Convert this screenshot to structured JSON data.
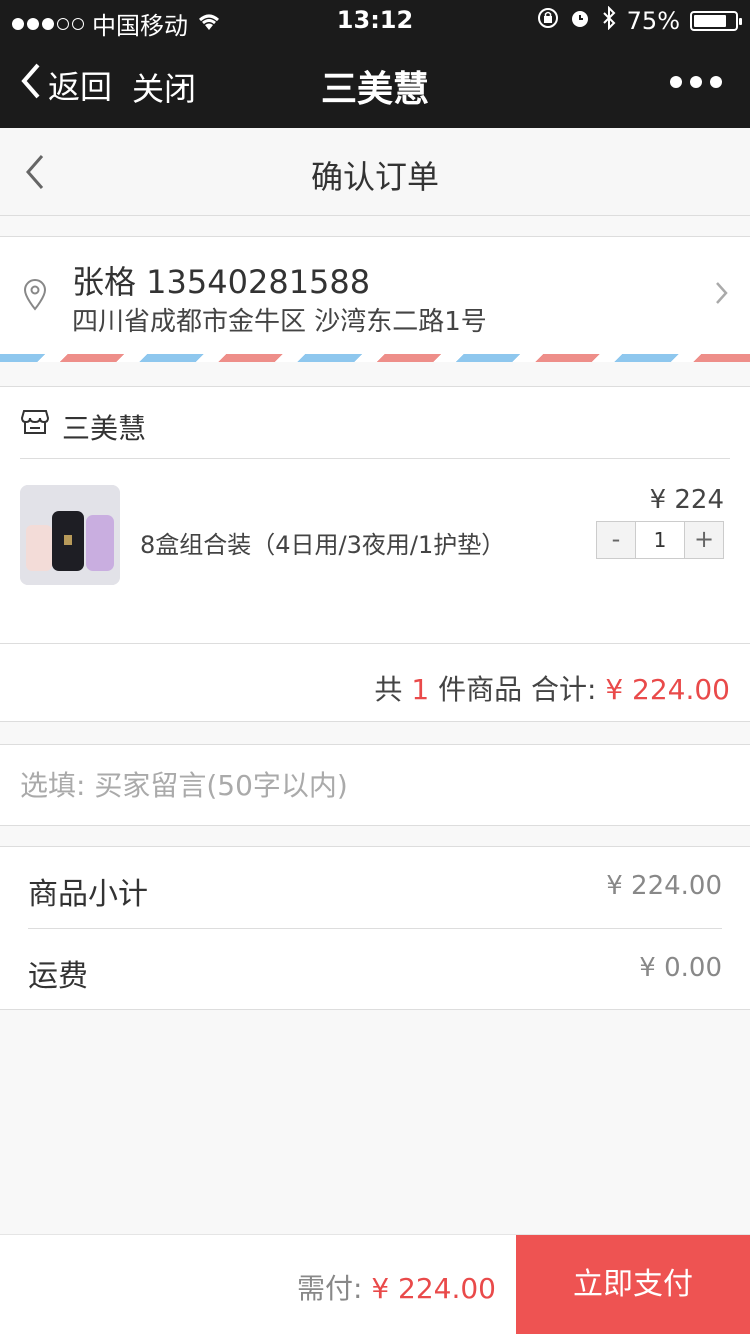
{
  "status_bar": {
    "carrier": "中国移动",
    "time": "13:12",
    "battery": "75%",
    "battery_level": 0.75,
    "icons": [
      "wifi-icon",
      "orientation-lock-icon",
      "alarm-icon",
      "bluetooth-icon",
      "battery-icon"
    ]
  },
  "nav": {
    "back_label": "返回",
    "close_label": "关闭",
    "title": "三美慧",
    "more_icon": "more-dots-icon"
  },
  "header": {
    "title": "确认订单"
  },
  "address": {
    "name_phone": "张格 13540281588",
    "detail": "四川省成都市金牛区 沙湾东二路1号"
  },
  "shop": {
    "name": "三美慧",
    "product": {
      "name": "8盒组合装（4日用/3夜用/1护垫）",
      "price": "¥ 224",
      "quantity": "1",
      "minus": "-",
      "plus": "+"
    },
    "total": {
      "prefix": "共",
      "count": "1",
      "middle": "件商品 合计:",
      "amount": "¥ 224.00"
    }
  },
  "message": {
    "placeholder": "选填: 买家留言(50字以内)"
  },
  "summary": {
    "subtotal_label": "商品小计",
    "subtotal_value": "¥ 224.00",
    "shipping_label": "运费",
    "shipping_value": "¥ 0.00"
  },
  "bottom": {
    "due_label": "需付:",
    "due_amount": "¥ 224.00",
    "pay_button": "立即支付"
  },
  "colors": {
    "accent": "#ee5352",
    "price_red": "#e94a4a",
    "nav_bg": "#1b1b1b"
  }
}
